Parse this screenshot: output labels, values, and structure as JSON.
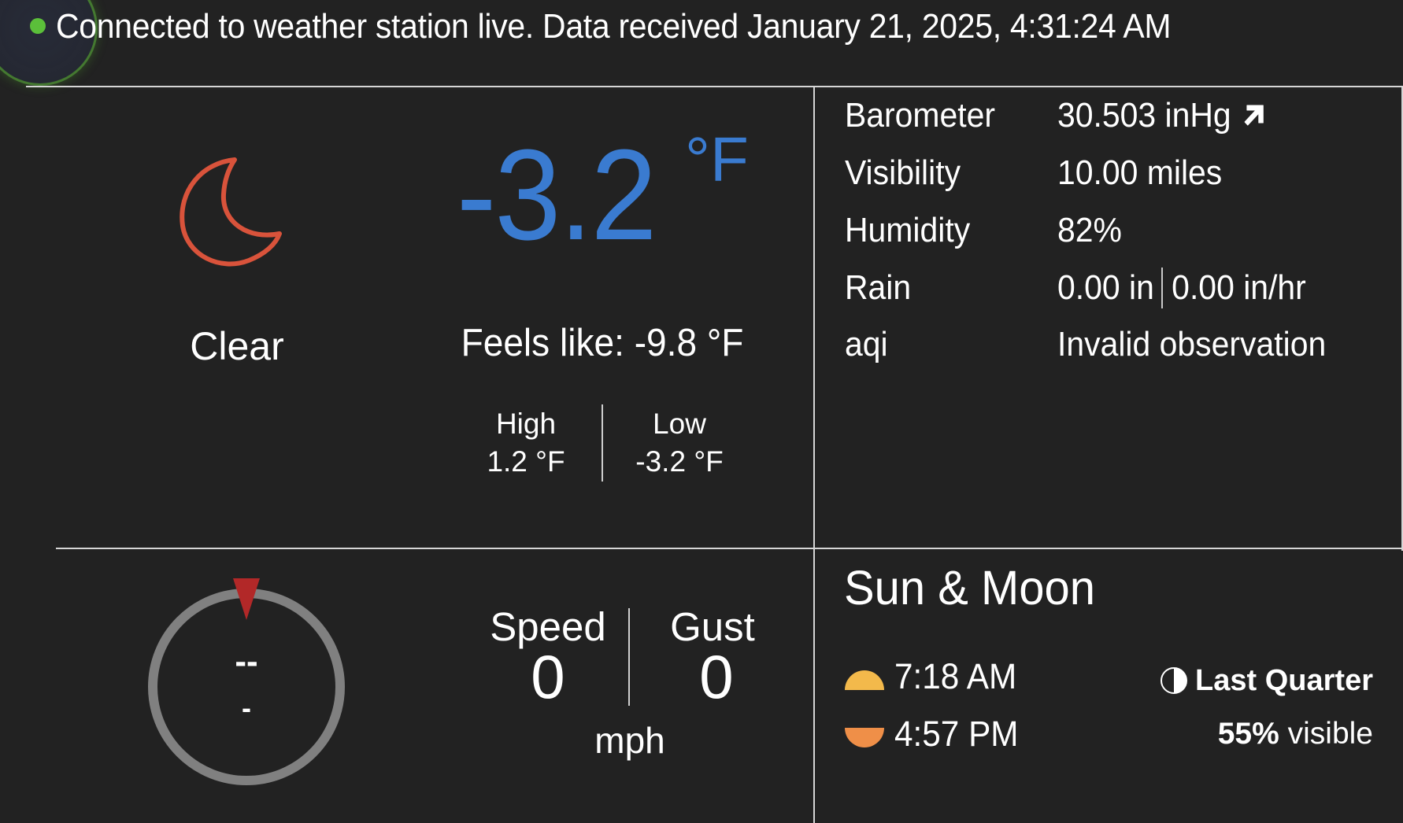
{
  "status": {
    "text": "Connected to weather station live. Data received January 21, 2025, 4:31:24 AM",
    "connected": true,
    "indicator_color": "#5bbf3a"
  },
  "current": {
    "condition_icon": "moon-outline-icon",
    "condition_icon_color": "#d9533b",
    "condition": "Clear",
    "temperature": "-3.2",
    "temperature_unit": "°F",
    "temperature_color": "#3a7bd0",
    "feels_like": "Feels like: -9.8 °F",
    "high_label": "High",
    "high_value": "1.2 °F",
    "low_label": "Low",
    "low_value": "-3.2 °F"
  },
  "details": [
    {
      "label": "Barometer",
      "value": "30.503 inHg",
      "trend_icon": "arrow-up-right-icon"
    },
    {
      "label": "Visibility",
      "value": "10.00 miles"
    },
    {
      "label": "Humidity",
      "value": "82%"
    },
    {
      "label": "Rain",
      "value": "0.00 in",
      "value2": "0.00 in/hr"
    },
    {
      "label": "aqi",
      "value": "Invalid observation"
    }
  ],
  "wind": {
    "direction": "--",
    "degrees": "-",
    "speed_label": "Speed",
    "speed_value": "0",
    "gust_label": "Gust",
    "gust_value": "0",
    "unit": "mph",
    "pointer_color": "#b22828"
  },
  "sun_moon": {
    "title": "Sun & Moon",
    "sunrise": "7:18 AM",
    "sunset": "4:57 PM",
    "sunrise_color": "#f3b94b",
    "sunset_color": "#ef8f48",
    "moon_phase": "Last Quarter",
    "moon_visible_pct": "55%",
    "moon_visible_suffix": " visible"
  }
}
